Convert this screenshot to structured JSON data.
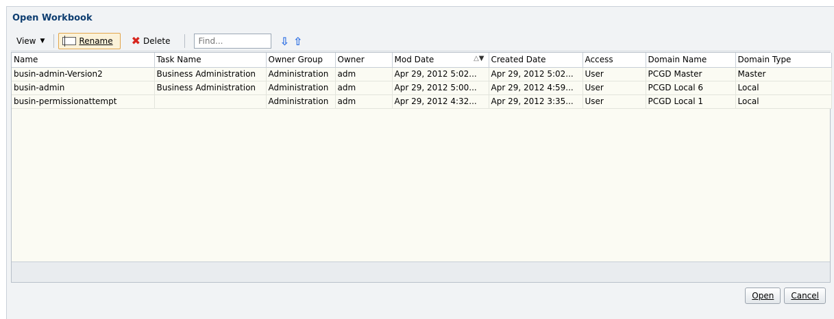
{
  "dialog": {
    "title": "Open Workbook"
  },
  "toolbar": {
    "view_label": "View",
    "rename_label": "Rename",
    "delete_label": "Delete",
    "find_placeholder": "Find..."
  },
  "grid": {
    "columns": [
      "Name",
      "Task Name",
      "Owner Group",
      "Owner",
      "Mod Date",
      "Created Date",
      "Access",
      "Domain Name",
      "Domain Type"
    ],
    "sort_column": "Mod Date",
    "rows": [
      [
        "busin-admin-Version2",
        "Business Administration",
        "Administration",
        "adm",
        "Apr 29, 2012 5:02...",
        "Apr 29, 2012 5:02...",
        "User",
        "PCGD Master",
        "Master"
      ],
      [
        "busin-admin",
        "Business Administration",
        "Administration",
        "adm",
        "Apr 29, 2012 5:00...",
        "Apr 29, 2012 4:59...",
        "User",
        "PCGD Local 6",
        "Local"
      ],
      [
        "busin-permissionattempt",
        "",
        "Administration",
        "adm",
        "Apr 29, 2012 4:32...",
        "Apr 29, 2012 3:35...",
        "User",
        "PCGD Local 1",
        "Local"
      ]
    ]
  },
  "footer": {
    "open_label": "Open",
    "cancel_label": "Cancel"
  },
  "colors": {
    "title": "#0d3d70",
    "accent_border": "#e2a54b",
    "delete": "#d7261e",
    "arrows": "#2d6fe3"
  }
}
